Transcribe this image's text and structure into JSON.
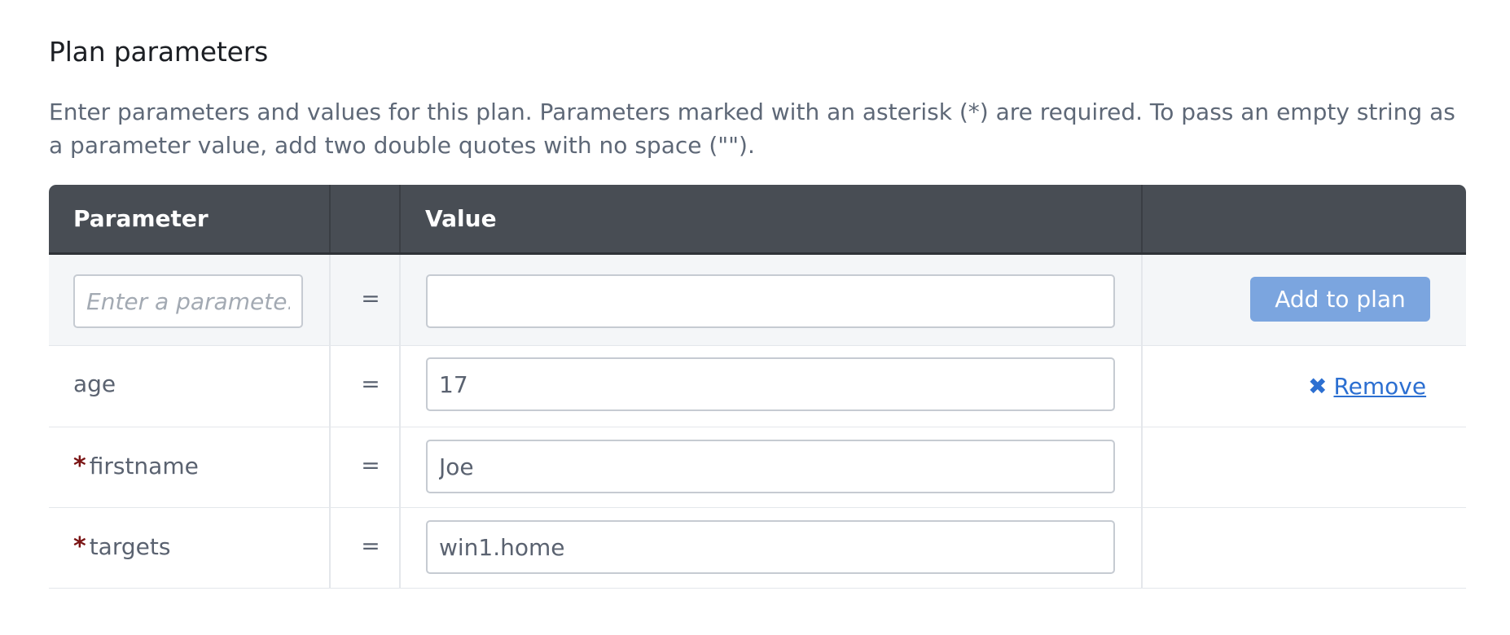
{
  "section": {
    "title": "Plan parameters",
    "description": "Enter parameters and values for this plan. Parameters marked with an asterisk (*) are required. To pass an empty string as a parameter value, add two double quotes with no space (\"\")."
  },
  "table": {
    "headers": {
      "parameter": "Parameter",
      "value": "Value"
    },
    "new_row": {
      "param_placeholder": "Enter a paramete...",
      "equals": "=",
      "value": "",
      "add_label": "Add to plan"
    },
    "rows": [
      {
        "name": "age",
        "required": false,
        "equals": "=",
        "value": "17",
        "remove_icon": "x-icon",
        "remove_label": "Remove"
      },
      {
        "name": "firstname",
        "required": true,
        "required_mark": "*",
        "equals": "=",
        "value": "Joe"
      },
      {
        "name": "targets",
        "required": true,
        "required_mark": "*",
        "equals": "=",
        "value": "win1.home"
      }
    ]
  },
  "colors": {
    "header_bg": "#484d54",
    "add_button": "#7ba5df",
    "link": "#2c6fd1",
    "required_mark": "#7a1414"
  }
}
